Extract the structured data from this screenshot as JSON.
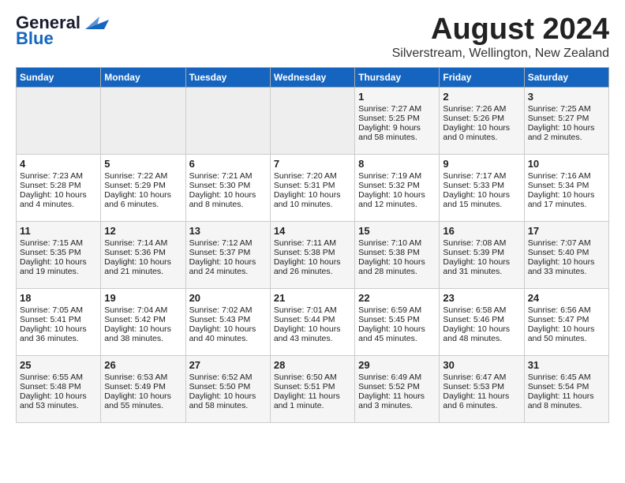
{
  "header": {
    "logo_general": "General",
    "logo_blue": "Blue",
    "month": "August 2024",
    "location": "Silverstream, Wellington, New Zealand"
  },
  "days_of_week": [
    "Sunday",
    "Monday",
    "Tuesday",
    "Wednesday",
    "Thursday",
    "Friday",
    "Saturday"
  ],
  "weeks": [
    [
      {
        "day": "",
        "sunrise": "",
        "sunset": "",
        "daylight": ""
      },
      {
        "day": "",
        "sunrise": "",
        "sunset": "",
        "daylight": ""
      },
      {
        "day": "",
        "sunrise": "",
        "sunset": "",
        "daylight": ""
      },
      {
        "day": "",
        "sunrise": "",
        "sunset": "",
        "daylight": ""
      },
      {
        "day": "1",
        "sunrise": "Sunrise: 7:27 AM",
        "sunset": "Sunset: 5:25 PM",
        "daylight": "Daylight: 9 hours and 58 minutes."
      },
      {
        "day": "2",
        "sunrise": "Sunrise: 7:26 AM",
        "sunset": "Sunset: 5:26 PM",
        "daylight": "Daylight: 10 hours and 0 minutes."
      },
      {
        "day": "3",
        "sunrise": "Sunrise: 7:25 AM",
        "sunset": "Sunset: 5:27 PM",
        "daylight": "Daylight: 10 hours and 2 minutes."
      }
    ],
    [
      {
        "day": "4",
        "sunrise": "Sunrise: 7:23 AM",
        "sunset": "Sunset: 5:28 PM",
        "daylight": "Daylight: 10 hours and 4 minutes."
      },
      {
        "day": "5",
        "sunrise": "Sunrise: 7:22 AM",
        "sunset": "Sunset: 5:29 PM",
        "daylight": "Daylight: 10 hours and 6 minutes."
      },
      {
        "day": "6",
        "sunrise": "Sunrise: 7:21 AM",
        "sunset": "Sunset: 5:30 PM",
        "daylight": "Daylight: 10 hours and 8 minutes."
      },
      {
        "day": "7",
        "sunrise": "Sunrise: 7:20 AM",
        "sunset": "Sunset: 5:31 PM",
        "daylight": "Daylight: 10 hours and 10 minutes."
      },
      {
        "day": "8",
        "sunrise": "Sunrise: 7:19 AM",
        "sunset": "Sunset: 5:32 PM",
        "daylight": "Daylight: 10 hours and 12 minutes."
      },
      {
        "day": "9",
        "sunrise": "Sunrise: 7:17 AM",
        "sunset": "Sunset: 5:33 PM",
        "daylight": "Daylight: 10 hours and 15 minutes."
      },
      {
        "day": "10",
        "sunrise": "Sunrise: 7:16 AM",
        "sunset": "Sunset: 5:34 PM",
        "daylight": "Daylight: 10 hours and 17 minutes."
      }
    ],
    [
      {
        "day": "11",
        "sunrise": "Sunrise: 7:15 AM",
        "sunset": "Sunset: 5:35 PM",
        "daylight": "Daylight: 10 hours and 19 minutes."
      },
      {
        "day": "12",
        "sunrise": "Sunrise: 7:14 AM",
        "sunset": "Sunset: 5:36 PM",
        "daylight": "Daylight: 10 hours and 21 minutes."
      },
      {
        "day": "13",
        "sunrise": "Sunrise: 7:12 AM",
        "sunset": "Sunset: 5:37 PM",
        "daylight": "Daylight: 10 hours and 24 minutes."
      },
      {
        "day": "14",
        "sunrise": "Sunrise: 7:11 AM",
        "sunset": "Sunset: 5:38 PM",
        "daylight": "Daylight: 10 hours and 26 minutes."
      },
      {
        "day": "15",
        "sunrise": "Sunrise: 7:10 AM",
        "sunset": "Sunset: 5:38 PM",
        "daylight": "Daylight: 10 hours and 28 minutes."
      },
      {
        "day": "16",
        "sunrise": "Sunrise: 7:08 AM",
        "sunset": "Sunset: 5:39 PM",
        "daylight": "Daylight: 10 hours and 31 minutes."
      },
      {
        "day": "17",
        "sunrise": "Sunrise: 7:07 AM",
        "sunset": "Sunset: 5:40 PM",
        "daylight": "Daylight: 10 hours and 33 minutes."
      }
    ],
    [
      {
        "day": "18",
        "sunrise": "Sunrise: 7:05 AM",
        "sunset": "Sunset: 5:41 PM",
        "daylight": "Daylight: 10 hours and 36 minutes."
      },
      {
        "day": "19",
        "sunrise": "Sunrise: 7:04 AM",
        "sunset": "Sunset: 5:42 PM",
        "daylight": "Daylight: 10 hours and 38 minutes."
      },
      {
        "day": "20",
        "sunrise": "Sunrise: 7:02 AM",
        "sunset": "Sunset: 5:43 PM",
        "daylight": "Daylight: 10 hours and 40 minutes."
      },
      {
        "day": "21",
        "sunrise": "Sunrise: 7:01 AM",
        "sunset": "Sunset: 5:44 PM",
        "daylight": "Daylight: 10 hours and 43 minutes."
      },
      {
        "day": "22",
        "sunrise": "Sunrise: 6:59 AM",
        "sunset": "Sunset: 5:45 PM",
        "daylight": "Daylight: 10 hours and 45 minutes."
      },
      {
        "day": "23",
        "sunrise": "Sunrise: 6:58 AM",
        "sunset": "Sunset: 5:46 PM",
        "daylight": "Daylight: 10 hours and 48 minutes."
      },
      {
        "day": "24",
        "sunrise": "Sunrise: 6:56 AM",
        "sunset": "Sunset: 5:47 PM",
        "daylight": "Daylight: 10 hours and 50 minutes."
      }
    ],
    [
      {
        "day": "25",
        "sunrise": "Sunrise: 6:55 AM",
        "sunset": "Sunset: 5:48 PM",
        "daylight": "Daylight: 10 hours and 53 minutes."
      },
      {
        "day": "26",
        "sunrise": "Sunrise: 6:53 AM",
        "sunset": "Sunset: 5:49 PM",
        "daylight": "Daylight: 10 hours and 55 minutes."
      },
      {
        "day": "27",
        "sunrise": "Sunrise: 6:52 AM",
        "sunset": "Sunset: 5:50 PM",
        "daylight": "Daylight: 10 hours and 58 minutes."
      },
      {
        "day": "28",
        "sunrise": "Sunrise: 6:50 AM",
        "sunset": "Sunset: 5:51 PM",
        "daylight": "Daylight: 11 hours and 1 minute."
      },
      {
        "day": "29",
        "sunrise": "Sunrise: 6:49 AM",
        "sunset": "Sunset: 5:52 PM",
        "daylight": "Daylight: 11 hours and 3 minutes."
      },
      {
        "day": "30",
        "sunrise": "Sunrise: 6:47 AM",
        "sunset": "Sunset: 5:53 PM",
        "daylight": "Daylight: 11 hours and 6 minutes."
      },
      {
        "day": "31",
        "sunrise": "Sunrise: 6:45 AM",
        "sunset": "Sunset: 5:54 PM",
        "daylight": "Daylight: 11 hours and 8 minutes."
      }
    ]
  ]
}
